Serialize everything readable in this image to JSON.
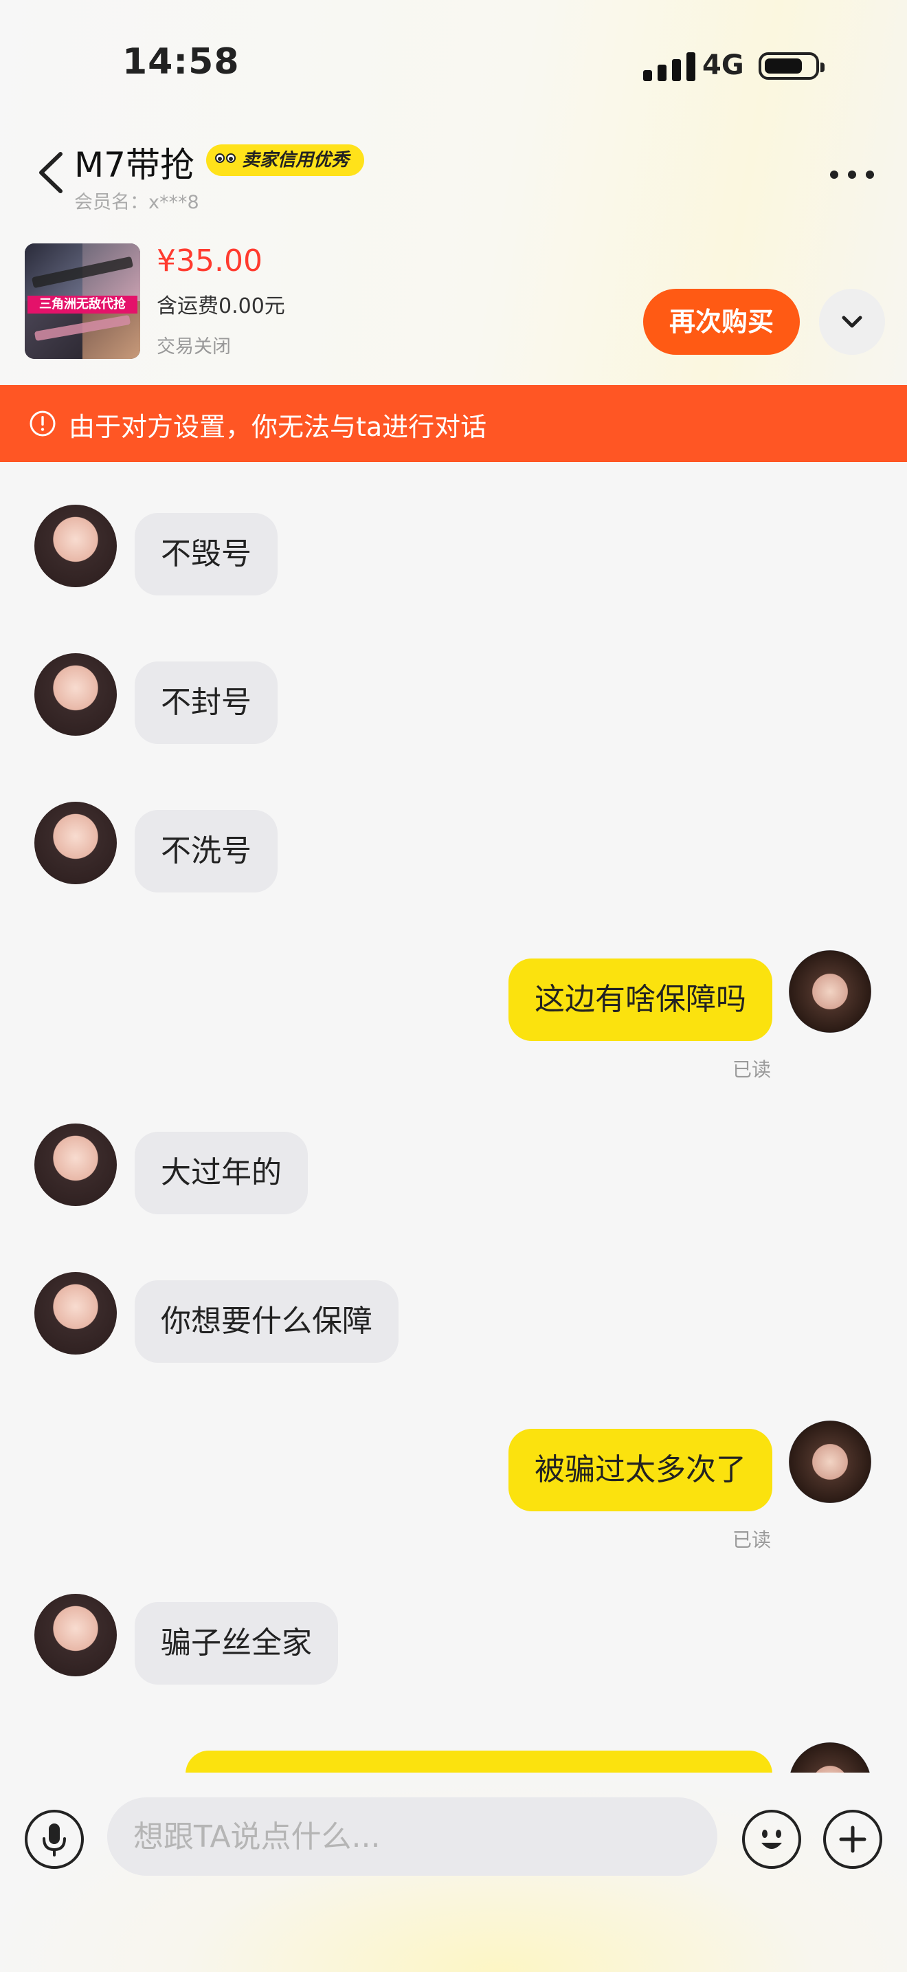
{
  "status_bar": {
    "time": "14:58",
    "network": "4G"
  },
  "header": {
    "title": "M7带抢",
    "badge": "卖家信用优秀",
    "member": "会员名：x***8"
  },
  "product": {
    "image_caption": "三角洲无敌代抢",
    "price": "¥35.00",
    "shipping": "含运费0.00元",
    "status": "交易关闭",
    "rebuy_label": "再次购买"
  },
  "banner": {
    "text": "由于对方设置，你无法与ta进行对话"
  },
  "messages": [
    {
      "from": "seller",
      "text": "不毁号"
    },
    {
      "from": "seller",
      "text": "不封号"
    },
    {
      "from": "seller",
      "text": "不洗号"
    },
    {
      "from": "me",
      "text": "这边有啥保障吗",
      "read": "已读"
    },
    {
      "from": "seller",
      "text": "大过年的"
    },
    {
      "from": "seller",
      "text": "你想要什么保障"
    },
    {
      "from": "me",
      "text": "被骗过太多次了",
      "read": "已读"
    },
    {
      "from": "seller",
      "text": "骗子丝全家"
    },
    {
      "from": "me",
      "text": ""
    }
  ],
  "input": {
    "placeholder": "想跟TA说点什么..."
  },
  "colors": {
    "accent": "#ff5a14",
    "banner": "#ff5624",
    "price": "#ff3b2f",
    "bubble_out": "#fbe20e",
    "bubble_in": "#e9e9ec",
    "badge": "#ffe21a"
  }
}
